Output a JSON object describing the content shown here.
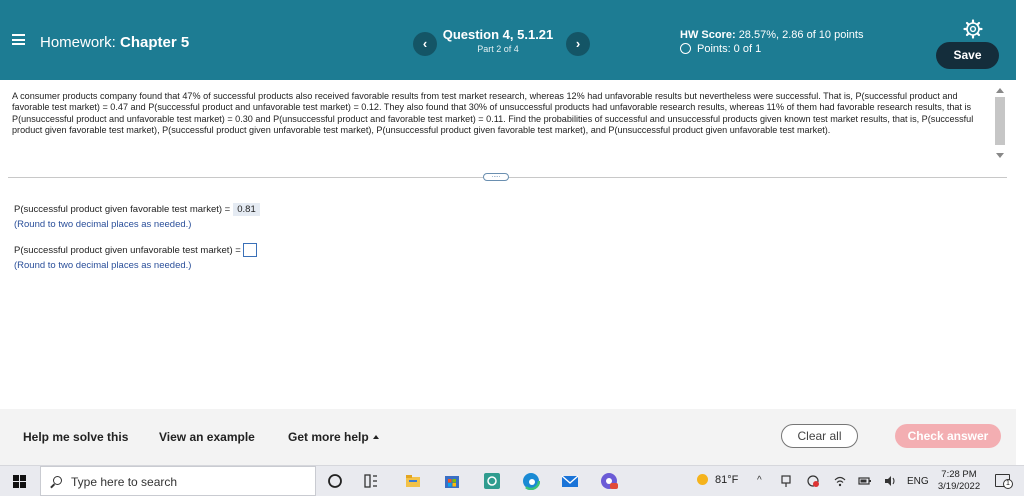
{
  "header": {
    "menu_label": "Homework:",
    "chapter_label": "Chapter 5",
    "question_title": "Question 4, 5.1.21",
    "question_part": "Part 2 of 4",
    "score_label": "HW Score:",
    "score_value": "28.57%, 2.86 of 10 points",
    "points_text": "Points: 0 of 1",
    "save_label": "Save",
    "prev_icon": "chevron-left-icon",
    "next_icon": "chevron-right-icon",
    "settings_icon": "gear-icon"
  },
  "question": {
    "text": "A consumer products company found that 47% of successful products also received favorable results from test market research, whereas 12% had unfavorable results but nevertheless were successful. That is, P(successful product and favorable test market) = 0.47 and P(successful product and unfavorable test market) = 0.12. They also found that 30% of unsuccessful products had unfavorable research results, whereas 11% of them had favorable research results, that is P(unsuccessful product and unfavorable test market) = 0.30 and P(unsuccessful product and favorable test market) = 0.11. Find the probabilities of successful and unsuccessful products given known test market results, that is, P(successful product given favorable test market), P(successful product given unfavorable test market), P(unsuccessful product given favorable test market), and P(unsuccessful product given unfavorable test market)."
  },
  "answers": {
    "a1_label": "P(successful product given favorable test market) =",
    "a1_value": "0.81",
    "a1_hint": "(Round to two decimal places as needed.)",
    "a2_label": "P(successful product given unfavorable test market) =",
    "a2_hint": "(Round to two decimal places as needed.)"
  },
  "footer": {
    "help_solve": "Help me solve this",
    "view_example": "View an example",
    "get_help": "Get more help",
    "clear_all": "Clear all",
    "check_answer": "Check answer"
  },
  "taskbar": {
    "search_placeholder": "Type here to search",
    "weather": "81°F",
    "language": "ENG",
    "time": "7:28 PM",
    "date": "3/19/2022",
    "notification_count": "1",
    "colors": {
      "header_bg": "#1d7c93",
      "check_answer_bg": "#f3aeb2",
      "save_bg": "#142d3b"
    }
  }
}
